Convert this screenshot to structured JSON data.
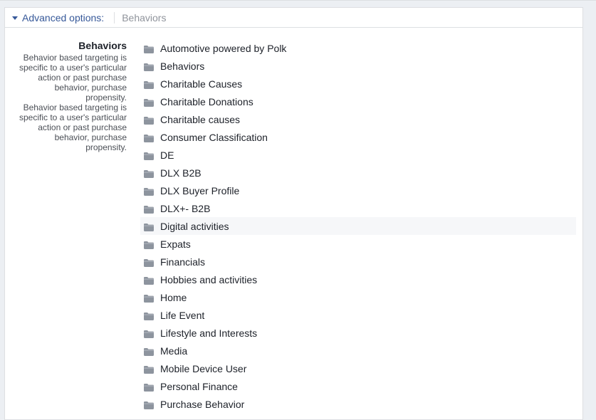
{
  "header": {
    "toggle_label": "Advanced options:",
    "breadcrumb": "Behaviors"
  },
  "description": {
    "title": "Behaviors",
    "lines": [
      "Behavior based targeting is",
      "specific to a user's particular",
      "action or past purchase",
      "behavior, purchase",
      "propensity.",
      "Behavior based targeting is",
      "specific to a user's particular",
      "action or past purchase",
      "behavior, purchase",
      "propensity."
    ]
  },
  "colors": {
    "link": "#365899",
    "folder_icon": "#8d949e",
    "highlight_row": "#f6f7f9"
  },
  "icons": {
    "folder": "folder-icon",
    "toggle": "caret-down-icon"
  },
  "categories": [
    {
      "label": "Automotive powered by Polk"
    },
    {
      "label": "Behaviors"
    },
    {
      "label": "Charitable Causes"
    },
    {
      "label": "Charitable Donations"
    },
    {
      "label": "Charitable causes"
    },
    {
      "label": "Consumer Classification"
    },
    {
      "label": "DE"
    },
    {
      "label": "DLX B2B"
    },
    {
      "label": "DLX Buyer Profile"
    },
    {
      "label": "DLX+- B2B"
    },
    {
      "label": "Digital activities",
      "highlighted": true
    },
    {
      "label": "Expats"
    },
    {
      "label": "Financials"
    },
    {
      "label": "Hobbies and activities"
    },
    {
      "label": "Home"
    },
    {
      "label": "Life Event"
    },
    {
      "label": "Lifestyle and Interests"
    },
    {
      "label": "Media"
    },
    {
      "label": "Mobile Device User"
    },
    {
      "label": "Personal Finance"
    },
    {
      "label": "Purchase Behavior"
    }
  ]
}
